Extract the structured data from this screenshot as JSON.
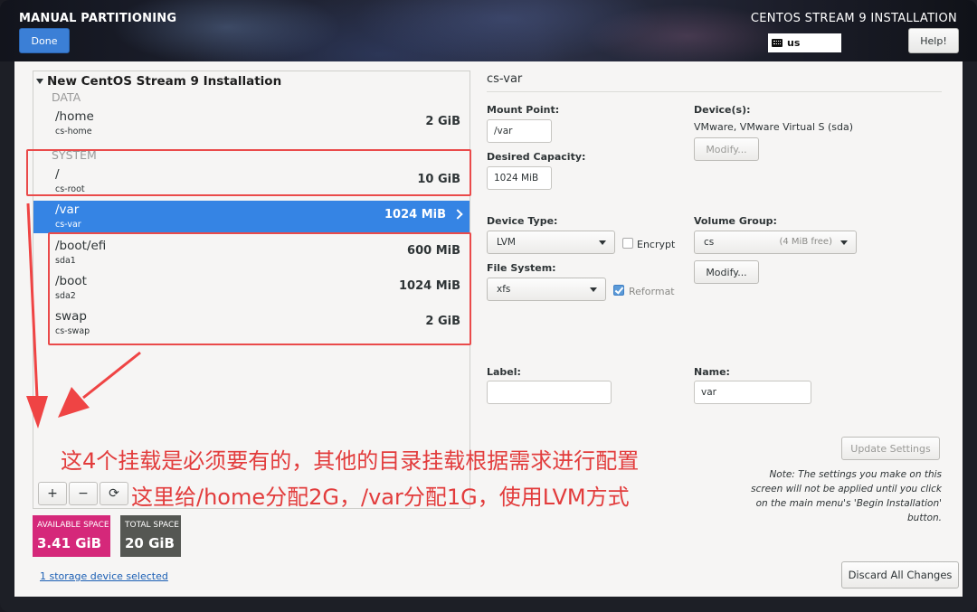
{
  "header": {
    "title": "MANUAL PARTITIONING",
    "done_label": "Done",
    "installer_title": "CENTOS STREAM 9 INSTALLATION",
    "keyboard_layout": "us",
    "help_label": "Help!"
  },
  "tree": {
    "root_label": "New CentOS Stream 9 Installation",
    "sections": {
      "data": "DATA",
      "system": "SYSTEM"
    },
    "items": [
      {
        "mount": "/home",
        "device": "cs-home",
        "size": "2 GiB"
      },
      {
        "mount": "/",
        "device": "cs-root",
        "size": "10 GiB"
      },
      {
        "mount": "/var",
        "device": "cs-var",
        "size": "1024 MiB",
        "selected": true
      },
      {
        "mount": "/boot/efi",
        "device": "sda1",
        "size": "600 MiB"
      },
      {
        "mount": "/boot",
        "device": "sda2",
        "size": "1024 MiB"
      },
      {
        "mount": "swap",
        "device": "cs-swap",
        "size": "2 GiB"
      }
    ]
  },
  "toolbar": {
    "add": "+",
    "remove": "−",
    "refresh": "⟳"
  },
  "space": {
    "available_label": "AVAILABLE SPACE",
    "available_value": "3.41 GiB",
    "available_color": "#d5287a",
    "total_label": "TOTAL SPACE",
    "total_value": "20 GiB",
    "total_color": "#555753"
  },
  "storage_link": "1 storage device selected",
  "discard_label": "Discard All Changes",
  "detail": {
    "title": "cs-var",
    "mount_point_label": "Mount Point:",
    "mount_point_value": "/var",
    "capacity_label": "Desired Capacity:",
    "capacity_value": "1024 MiB",
    "devices_label": "Device(s):",
    "devices_value": "VMware, VMware Virtual S (sda)",
    "modify_label": "Modify...",
    "device_type_label": "Device Type:",
    "device_type_value": "LVM",
    "encrypt_label": "Encrypt",
    "volume_group_label": "Volume Group:",
    "volume_group_value": "cs",
    "volume_group_free": "(4 MiB free)",
    "file_system_label": "File System:",
    "file_system_value": "xfs",
    "reformat_label": "Reformat",
    "label_label": "Label:",
    "label_value": "",
    "name_label": "Name:",
    "name_value": "var",
    "update_label": "Update Settings",
    "note": "Note:  The settings you make on this screen will not be applied until you click on the main menu's 'Begin Installation' button."
  },
  "annotation": {
    "line1": "这4个挂载是必须要有的，其他的目录挂载根据需求进行配置",
    "line2": "这里给/home分配2G，/var分配1G，使用LVM方式",
    "color": "#e23c3c"
  }
}
